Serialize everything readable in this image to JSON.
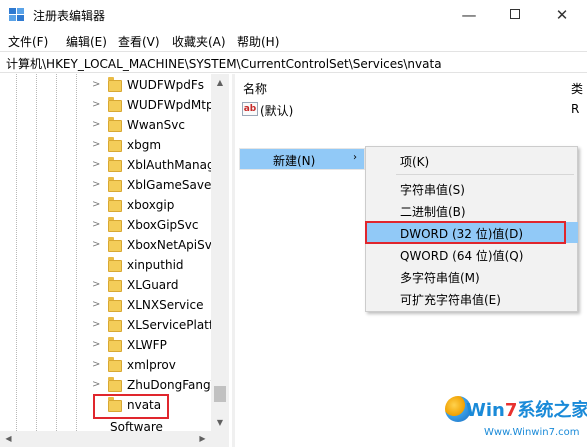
{
  "window": {
    "title": "注册表编辑器",
    "controls": {
      "minimize": "—",
      "close": "✕"
    }
  },
  "menubar": {
    "items": [
      "文件(F)",
      "编辑(E)",
      "查看(V)",
      "收藏夹(A)",
      "帮助(H)"
    ]
  },
  "address": {
    "path": "计算机\\HKEY_LOCAL_MACHINE\\SYSTEM\\CurrentControlSet\\Services\\nvata"
  },
  "tree": {
    "items": [
      "WUDFWpdFs",
      "WUDFWpdMtp",
      "WwanSvc",
      "xbgm",
      "XblAuthManag",
      "XblGameSave",
      "xboxgip",
      "XboxGipSvc",
      "XboxNetApiSvc",
      "xinputhid",
      "XLGuard",
      "XLNXService",
      "XLServicePlatfo",
      "XLWFP",
      "xmlprov",
      "ZhuDongFangY",
      "nvata"
    ],
    "next_item": "Software",
    "selected": "nvata"
  },
  "list": {
    "columns": {
      "name": "名称",
      "type": "类"
    },
    "rows": [
      {
        "name": "(默认)",
        "type": "R",
        "icon": "ab-string-icon"
      }
    ]
  },
  "context_menu": {
    "parent_label": "新建(N)",
    "parent_arrow": "›",
    "items": [
      {
        "label": "项(K)"
      },
      {
        "label": "字符串值(S)"
      },
      {
        "label": "二进制值(B)"
      },
      {
        "label": "DWORD (32 位)值(D)",
        "highlighted": true
      },
      {
        "label": "QWORD (64 位)值(Q)"
      },
      {
        "label": "多字符串值(M)"
      },
      {
        "label": "可扩充字符串值(E)"
      }
    ]
  },
  "watermark": {
    "logo_left": "Win",
    "logo_seven": "7",
    "logo_right": "系统之家",
    "url": "Www.Winwin7.com"
  },
  "colors": {
    "highlight": "#91c9f7",
    "annotation_box": "#e0262d",
    "folder": "#f4cd59"
  }
}
